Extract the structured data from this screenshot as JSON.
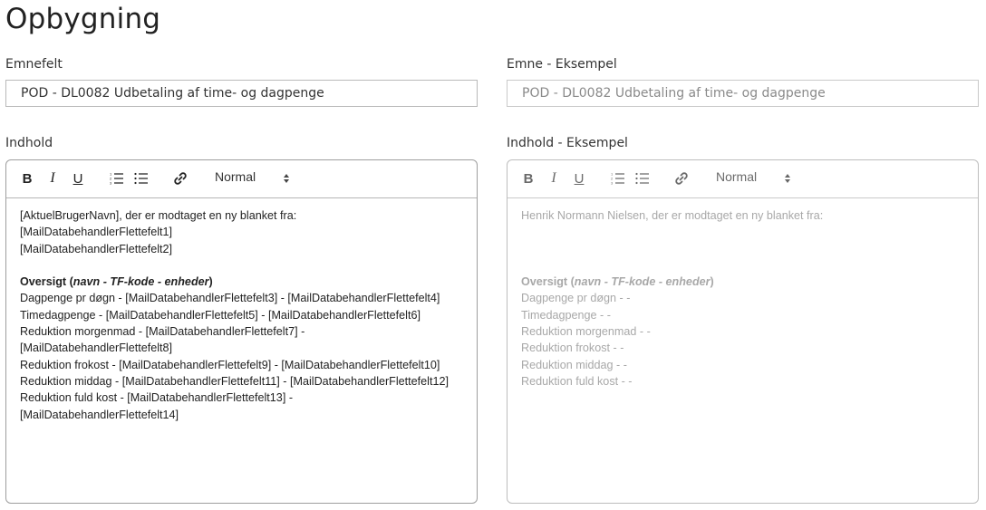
{
  "page": {
    "title": "Opbygning"
  },
  "subject": {
    "label": "Emnefelt",
    "value": "POD - DL0082 Udbetaling af time- og dagpenge"
  },
  "subject_example": {
    "label": "Emne - Eksempel",
    "value": "POD - DL0082 Udbetaling af time- og dagpenge"
  },
  "content": {
    "label": "Indhold",
    "toolbar": {
      "bold": "B",
      "italic": "I",
      "underline": "U",
      "format": "Normal"
    },
    "lines": [
      "[AktuelBrugerNavn], der er modtaget en ny blanket fra:",
      "[MailDatabehandlerFlettefelt1]",
      "[MailDatabehandlerFlettefelt2]",
      "",
      "Dagpenge pr døgn - [MailDatabehandlerFlettefelt3] - [MailDatabehandlerFlettefelt4]",
      "Timedagpenge - [MailDatabehandlerFlettefelt5] - [MailDatabehandlerFlettefelt6]",
      "Reduktion morgenmad - [MailDatabehandlerFlettefelt7] -",
      "[MailDatabehandlerFlettefelt8]",
      "Reduktion frokost - [MailDatabehandlerFlettefelt9] - [MailDatabehandlerFlettefelt10]",
      "Reduktion middag - [MailDatabehandlerFlettefelt11] - [MailDatabehandlerFlettefelt12]",
      "Reduktion fuld kost - [MailDatabehandlerFlettefelt13] -",
      "[MailDatabehandlerFlettefelt14]"
    ],
    "overview": {
      "prefix": "Oversigt (",
      "emph": "navn - TF-kode - enheder",
      "suffix": ")"
    }
  },
  "content_example": {
    "label": "Indhold - Eksempel",
    "toolbar": {
      "bold": "B",
      "italic": "I",
      "underline": "U",
      "format": "Normal"
    },
    "lines": [
      "Henrik Normann Nielsen, der er modtaget en ny blanket fra:",
      "Dagpenge pr døgn -  -",
      "Timedagpenge -  -",
      "Reduktion morgenmad -  -",
      "Reduktion frokost -  -",
      "Reduktion middag -  -",
      "Reduktion fuld kost -  -"
    ],
    "overview": {
      "prefix": "Oversigt (",
      "emph": "navn - TF-kode - enheder",
      "suffix": ")"
    }
  },
  "icons": [
    "bold-icon",
    "italic-icon",
    "underline-icon",
    "ordered-list-icon",
    "bullet-list-icon",
    "link-icon",
    "select-arrows-icon"
  ]
}
